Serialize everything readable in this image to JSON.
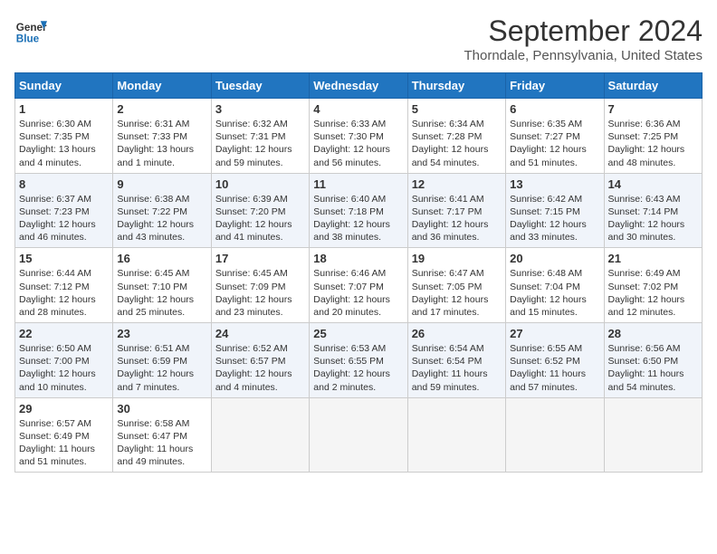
{
  "header": {
    "logo_line1": "General",
    "logo_line2": "Blue",
    "month": "September 2024",
    "location": "Thorndale, Pennsylvania, United States"
  },
  "days_of_week": [
    "Sunday",
    "Monday",
    "Tuesday",
    "Wednesday",
    "Thursday",
    "Friday",
    "Saturday"
  ],
  "weeks": [
    [
      {
        "day": "1",
        "sunrise": "Sunrise: 6:30 AM",
        "sunset": "Sunset: 7:35 PM",
        "daylight": "Daylight: 13 hours and 4 minutes."
      },
      {
        "day": "2",
        "sunrise": "Sunrise: 6:31 AM",
        "sunset": "Sunset: 7:33 PM",
        "daylight": "Daylight: 13 hours and 1 minute."
      },
      {
        "day": "3",
        "sunrise": "Sunrise: 6:32 AM",
        "sunset": "Sunset: 7:31 PM",
        "daylight": "Daylight: 12 hours and 59 minutes."
      },
      {
        "day": "4",
        "sunrise": "Sunrise: 6:33 AM",
        "sunset": "Sunset: 7:30 PM",
        "daylight": "Daylight: 12 hours and 56 minutes."
      },
      {
        "day": "5",
        "sunrise": "Sunrise: 6:34 AM",
        "sunset": "Sunset: 7:28 PM",
        "daylight": "Daylight: 12 hours and 54 minutes."
      },
      {
        "day": "6",
        "sunrise": "Sunrise: 6:35 AM",
        "sunset": "Sunset: 7:27 PM",
        "daylight": "Daylight: 12 hours and 51 minutes."
      },
      {
        "day": "7",
        "sunrise": "Sunrise: 6:36 AM",
        "sunset": "Sunset: 7:25 PM",
        "daylight": "Daylight: 12 hours and 48 minutes."
      }
    ],
    [
      {
        "day": "8",
        "sunrise": "Sunrise: 6:37 AM",
        "sunset": "Sunset: 7:23 PM",
        "daylight": "Daylight: 12 hours and 46 minutes."
      },
      {
        "day": "9",
        "sunrise": "Sunrise: 6:38 AM",
        "sunset": "Sunset: 7:22 PM",
        "daylight": "Daylight: 12 hours and 43 minutes."
      },
      {
        "day": "10",
        "sunrise": "Sunrise: 6:39 AM",
        "sunset": "Sunset: 7:20 PM",
        "daylight": "Daylight: 12 hours and 41 minutes."
      },
      {
        "day": "11",
        "sunrise": "Sunrise: 6:40 AM",
        "sunset": "Sunset: 7:18 PM",
        "daylight": "Daylight: 12 hours and 38 minutes."
      },
      {
        "day": "12",
        "sunrise": "Sunrise: 6:41 AM",
        "sunset": "Sunset: 7:17 PM",
        "daylight": "Daylight: 12 hours and 36 minutes."
      },
      {
        "day": "13",
        "sunrise": "Sunrise: 6:42 AM",
        "sunset": "Sunset: 7:15 PM",
        "daylight": "Daylight: 12 hours and 33 minutes."
      },
      {
        "day": "14",
        "sunrise": "Sunrise: 6:43 AM",
        "sunset": "Sunset: 7:14 PM",
        "daylight": "Daylight: 12 hours and 30 minutes."
      }
    ],
    [
      {
        "day": "15",
        "sunrise": "Sunrise: 6:44 AM",
        "sunset": "Sunset: 7:12 PM",
        "daylight": "Daylight: 12 hours and 28 minutes."
      },
      {
        "day": "16",
        "sunrise": "Sunrise: 6:45 AM",
        "sunset": "Sunset: 7:10 PM",
        "daylight": "Daylight: 12 hours and 25 minutes."
      },
      {
        "day": "17",
        "sunrise": "Sunrise: 6:45 AM",
        "sunset": "Sunset: 7:09 PM",
        "daylight": "Daylight: 12 hours and 23 minutes."
      },
      {
        "day": "18",
        "sunrise": "Sunrise: 6:46 AM",
        "sunset": "Sunset: 7:07 PM",
        "daylight": "Daylight: 12 hours and 20 minutes."
      },
      {
        "day": "19",
        "sunrise": "Sunrise: 6:47 AM",
        "sunset": "Sunset: 7:05 PM",
        "daylight": "Daylight: 12 hours and 17 minutes."
      },
      {
        "day": "20",
        "sunrise": "Sunrise: 6:48 AM",
        "sunset": "Sunset: 7:04 PM",
        "daylight": "Daylight: 12 hours and 15 minutes."
      },
      {
        "day": "21",
        "sunrise": "Sunrise: 6:49 AM",
        "sunset": "Sunset: 7:02 PM",
        "daylight": "Daylight: 12 hours and 12 minutes."
      }
    ],
    [
      {
        "day": "22",
        "sunrise": "Sunrise: 6:50 AM",
        "sunset": "Sunset: 7:00 PM",
        "daylight": "Daylight: 12 hours and 10 minutes."
      },
      {
        "day": "23",
        "sunrise": "Sunrise: 6:51 AM",
        "sunset": "Sunset: 6:59 PM",
        "daylight": "Daylight: 12 hours and 7 minutes."
      },
      {
        "day": "24",
        "sunrise": "Sunrise: 6:52 AM",
        "sunset": "Sunset: 6:57 PM",
        "daylight": "Daylight: 12 hours and 4 minutes."
      },
      {
        "day": "25",
        "sunrise": "Sunrise: 6:53 AM",
        "sunset": "Sunset: 6:55 PM",
        "daylight": "Daylight: 12 hours and 2 minutes."
      },
      {
        "day": "26",
        "sunrise": "Sunrise: 6:54 AM",
        "sunset": "Sunset: 6:54 PM",
        "daylight": "Daylight: 11 hours and 59 minutes."
      },
      {
        "day": "27",
        "sunrise": "Sunrise: 6:55 AM",
        "sunset": "Sunset: 6:52 PM",
        "daylight": "Daylight: 11 hours and 57 minutes."
      },
      {
        "day": "28",
        "sunrise": "Sunrise: 6:56 AM",
        "sunset": "Sunset: 6:50 PM",
        "daylight": "Daylight: 11 hours and 54 minutes."
      }
    ],
    [
      {
        "day": "29",
        "sunrise": "Sunrise: 6:57 AM",
        "sunset": "Sunset: 6:49 PM",
        "daylight": "Daylight: 11 hours and 51 minutes."
      },
      {
        "day": "30",
        "sunrise": "Sunrise: 6:58 AM",
        "sunset": "Sunset: 6:47 PM",
        "daylight": "Daylight: 11 hours and 49 minutes."
      },
      null,
      null,
      null,
      null,
      null
    ]
  ]
}
